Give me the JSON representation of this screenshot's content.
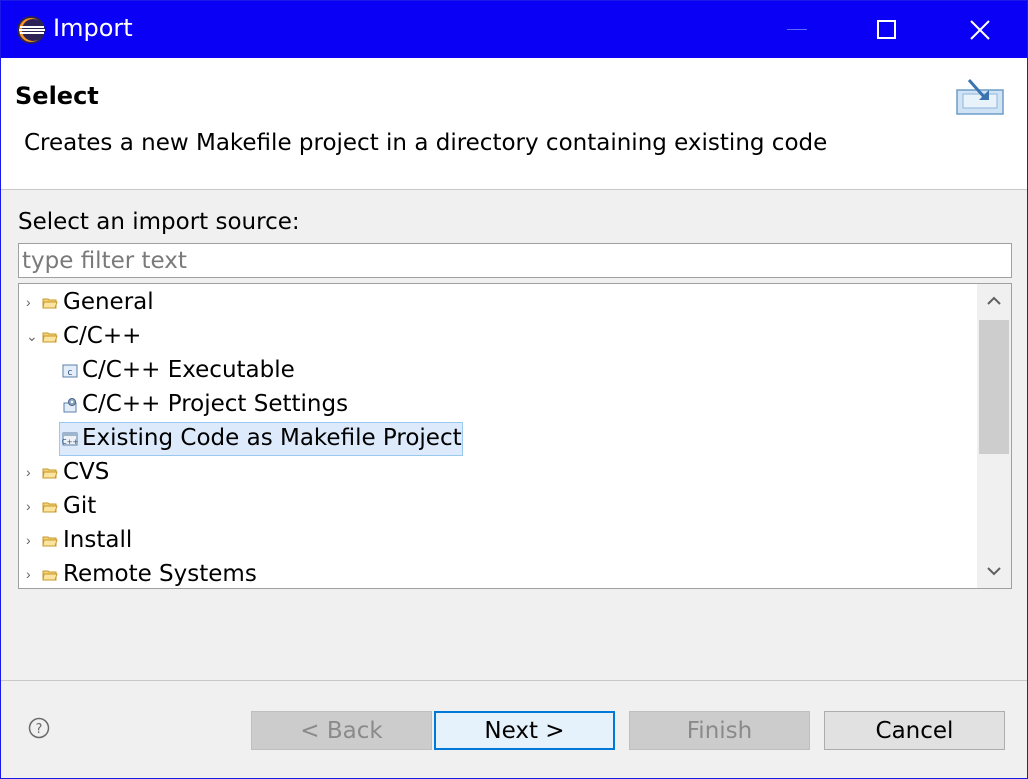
{
  "window": {
    "title": "Import",
    "controls": {
      "minimize_icon": "minimize-icon",
      "maximize_icon": "maximize-icon",
      "close_icon": "close-icon"
    },
    "accent": "#0a00f5"
  },
  "header": {
    "title": "Select",
    "description": "Creates a new Makefile project in a directory containing existing code",
    "icon": "import-wizard-icon"
  },
  "source": {
    "label": "Select an import source:",
    "filter_placeholder": "type filter text",
    "filter_value": ""
  },
  "tree": {
    "items": [
      {
        "label": "General",
        "type": "folder",
        "expanded": false,
        "depth": 0
      },
      {
        "label": "C/C++",
        "type": "folder",
        "expanded": true,
        "depth": 0
      },
      {
        "label": "C/C++ Executable",
        "type": "file",
        "depth": 1
      },
      {
        "label": "C/C++ Project Settings",
        "type": "file",
        "depth": 1
      },
      {
        "label": "Existing Code as Makefile Project",
        "type": "file",
        "depth": 1,
        "selected": true
      },
      {
        "label": "CVS",
        "type": "folder",
        "expanded": false,
        "depth": 0
      },
      {
        "label": "Git",
        "type": "folder",
        "expanded": false,
        "depth": 0
      },
      {
        "label": "Install",
        "type": "folder",
        "expanded": false,
        "depth": 0
      },
      {
        "label": "Remote Systems",
        "type": "folder",
        "expanded": false,
        "depth": 0
      }
    ],
    "selection_color": "#dceafc"
  },
  "footer": {
    "help_icon": "help-icon",
    "back_label": "< Back",
    "next_label": "Next >",
    "finish_label": "Finish",
    "cancel_label": "Cancel",
    "back_enabled": false,
    "finish_enabled": false
  }
}
